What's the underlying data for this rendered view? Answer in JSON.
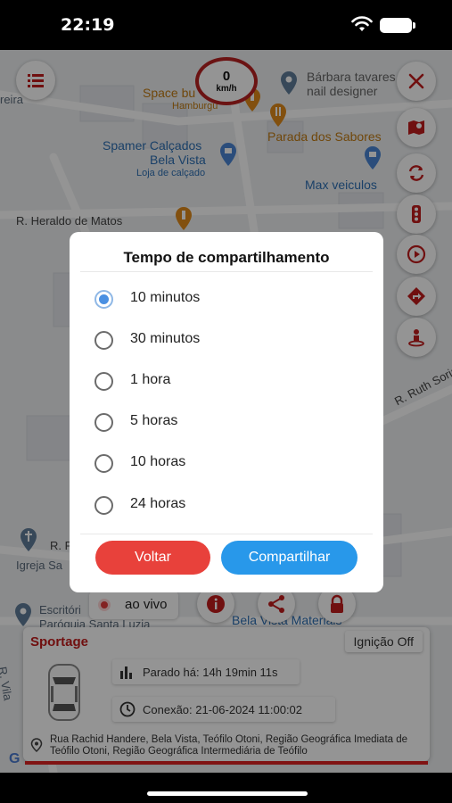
{
  "status_bar": {
    "time": "22:19"
  },
  "map": {
    "speed": {
      "value": "0",
      "unit": "km/h"
    },
    "labels": {
      "street_reira": "reira",
      "space": "Space bu",
      "hamburguer": "Hamburgu",
      "barbara_1": "Bárbara tavares",
      "barbara_2": "nail designer",
      "spamer": "Spamer Calçados",
      "bela_vista": "Bela Vista",
      "loja": "Loja de calçado",
      "parada": "Parada dos Sabores",
      "max": "Max veiculos",
      "heraldo": "R. Heraldo de Matos",
      "ruth": "R. Ruth Soriano",
      "r_p": "R. P",
      "igreja": "Igreja Sa",
      "escritorio": "Escritóri",
      "paroquia": "Paróquia Santa Luzia",
      "bela_vista_materiais": "Bela Vista Materiais",
      "r_vila": "R. Vila",
      "google": "G"
    }
  },
  "live": {
    "label": "ao vivo"
  },
  "vehicle": {
    "name": "Sportage",
    "ignition": "Ignição Off",
    "stopped": "Parado há: 14h 19min 11s",
    "connection": "Conexão: 21-06-2024 11:00:02",
    "address": "Rua Rachid Handere, Bela Vista, Teófilo Otoni, Região Geográfica Imediata de Teófilo Otoni, Região Geográfica Intermediária de Teófilo"
  },
  "dialog": {
    "title": "Tempo de compartilhamento",
    "options": [
      {
        "label": "10 minutos",
        "selected": true
      },
      {
        "label": "30 minutos",
        "selected": false
      },
      {
        "label": "1 hora",
        "selected": false
      },
      {
        "label": "5 horas",
        "selected": false
      },
      {
        "label": "10 horas",
        "selected": false
      },
      {
        "label": "24 horas",
        "selected": false
      }
    ],
    "back_label": "Voltar",
    "share_label": "Compartilhar"
  },
  "colors": {
    "accent_red": "#e8413b",
    "accent_blue": "#2898ea",
    "vehicle_name": "#c21c1c"
  }
}
